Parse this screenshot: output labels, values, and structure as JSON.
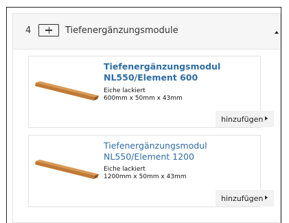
{
  "section": {
    "step_number": "4",
    "title": "Tiefenergänzungsmodule",
    "icons": {
      "add": "plus-box-icon",
      "toggle": "caret-up-icon"
    }
  },
  "products": [
    {
      "title": "Tiefenergänzungsmodul NL550/Element 600",
      "material": "Eiche lackiert",
      "dimensions": "600mm x 50mm x 43mm",
      "button_label": "hinzufügen",
      "image": "wood-beam-image"
    },
    {
      "title": "Tiefenergänzungsmodul NL550/Element 1200",
      "material": "Eiche lackiert",
      "dimensions": "1200mm x 50mm x 43mm",
      "button_label": "hinzufügen",
      "image": "wood-beam-image"
    }
  ],
  "colors": {
    "link": "#2e6da4",
    "wood_light": "#c9843e",
    "wood_dark": "#9b5e27",
    "header_bg": "#f6f6f6",
    "button_bg": "#f2f2f2"
  }
}
